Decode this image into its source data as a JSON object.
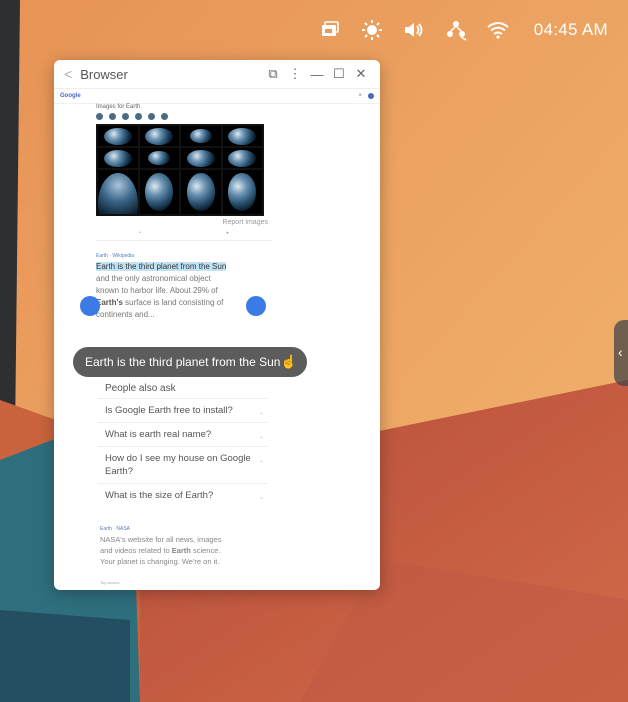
{
  "statusbar": {
    "icons": [
      "window-switch-icon",
      "brightness-icon",
      "volume-icon",
      "network-icon",
      "wifi-icon"
    ],
    "time": "04:45 AM"
  },
  "colors": {
    "wallpaper_orange": "#e89a5a",
    "wallpaper_red": "#c0573f",
    "wallpaper_teal": "#2f6e7c",
    "selection_handle": "#3a7be6",
    "highlight": "#bfe3f4"
  },
  "browser": {
    "title": "Browser",
    "search_engine": "Google",
    "images_label": "Images for Earth",
    "chips": [
      "",
      "",
      "",
      "",
      "",
      ""
    ],
    "report_images": "Report images",
    "snippet": {
      "source": "Earth · Wikipedia",
      "highlighted": "Earth is the third planet from the Sun",
      "line2": "and the only astronomical object",
      "line3": "known to harbor life. About 29% of",
      "line4_bold": "Earth's",
      "line4_rest": " surface is land consisting of",
      "line5": "continents and..."
    },
    "people_also_ask": {
      "title": "People also ask",
      "questions": [
        "Is Google Earth free to install?",
        "What is earth real name?",
        "How do I see my house on Google Earth?",
        "What is the size of Earth?"
      ]
    },
    "nasa": {
      "source": "Earth · NASA",
      "line1": "NASA's website for all news, images",
      "line2_pre": "and videos related to ",
      "line2_bold": "Earth",
      "line2_post": " science.",
      "line3": "Your planet is changing. We're on it."
    },
    "top_stories": "Top stories"
  },
  "selection_toolbar": {
    "text": "Earth is the third planet from the Sun"
  }
}
